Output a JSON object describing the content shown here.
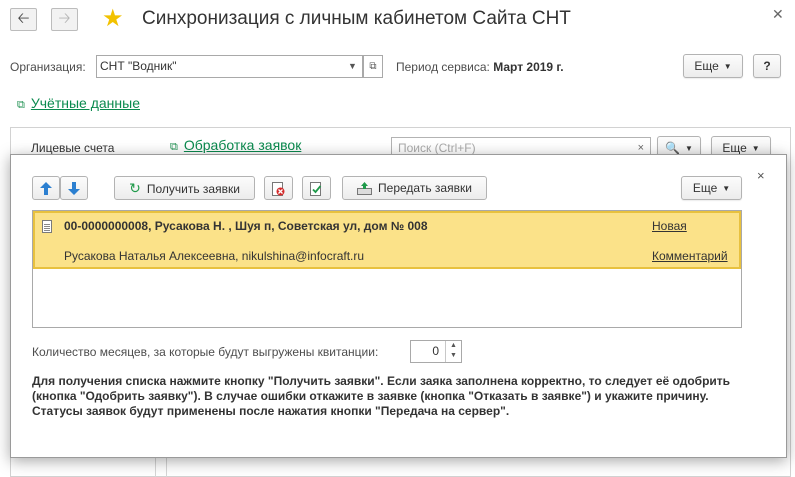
{
  "window": {
    "title": "Синхронизация с личным кабинетом Сайта СНТ",
    "back_icon": "arrow-left-icon",
    "forward_icon": "arrow-right-icon",
    "favorite_icon": "star-icon",
    "close_icon": "close-icon"
  },
  "organization": {
    "label": "Организация:",
    "value": "СНТ \"Водник\""
  },
  "service_period": {
    "label": "Период сервиса:",
    "value": "Март 2019 г."
  },
  "header_buttons": {
    "more_label": "Еще",
    "help_label": "?"
  },
  "links": {
    "credentials": "Учётные данные",
    "process_requests": "Обработка заявок"
  },
  "background_form": {
    "tab_label": "Лицевые счета",
    "search_placeholder": "Поиск (Ctrl+F)",
    "search_clear": "×",
    "more_label": "Еще"
  },
  "dialog": {
    "close": "×",
    "toolbar": {
      "get_requests_label": "Получить заявки",
      "send_requests_label": "Передать заявки",
      "more_label": "Еще"
    },
    "requests": [
      {
        "title": "00-0000000008,  Русакова Н.  , Шуя п, Советская ул, дом № 008",
        "subtitle": "Русакова Наталья Алексеевна, nikulshina@infocraft.ru",
        "status": "Новая",
        "comment_link": "Комментарий"
      }
    ],
    "months_label": "Количество месяцев, за которые будут выгружены квитанции:",
    "months_value": "0",
    "hint": "Для получения списка нажмите кнопку \"Получить заявки\". Если заяка заполнена корректно, то следует её одобрить (кнопка \"Одобрить заявку\"). В случае ошибки откажите в заявке (кнопка \"Отказать в заявке\") и укажите причину. Статусы заявок будут применены после нажатия кнопки \"Передача на сервер\"."
  },
  "colors": {
    "selection_bg": "#fbe289",
    "selection_border": "#e8c13e",
    "link_green": "#0a8a4e",
    "star": "#f2c200"
  }
}
